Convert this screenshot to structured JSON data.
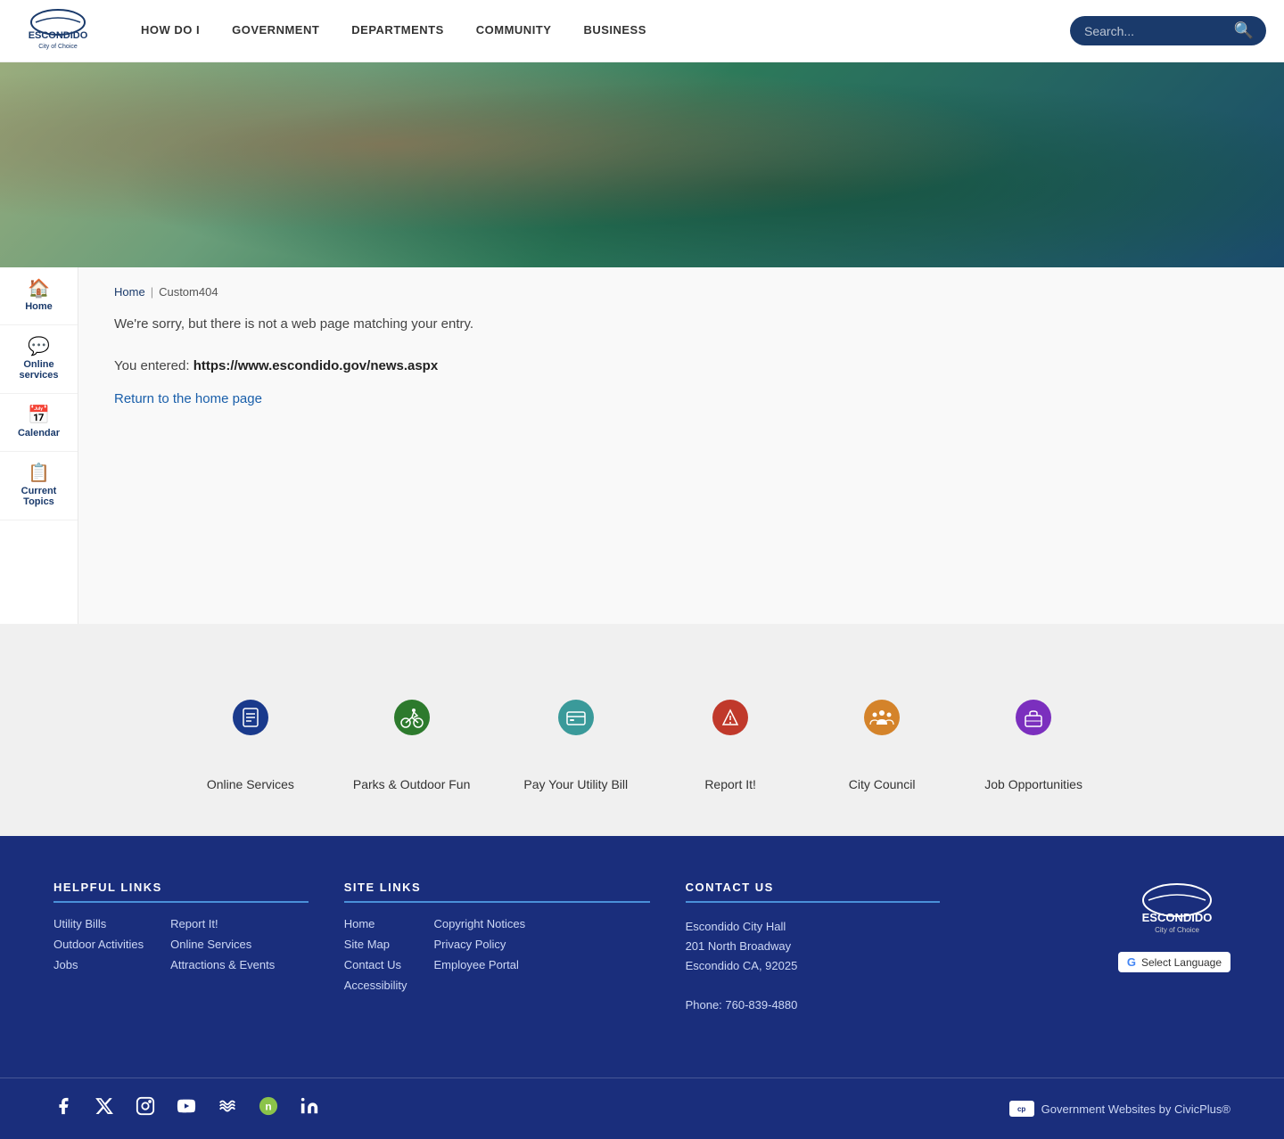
{
  "header": {
    "logo_alt": "Escondido City of Choice",
    "nav_items": [
      {
        "label": "HOW DO I",
        "id": "how-do-i"
      },
      {
        "label": "GOVERNMENT",
        "id": "government"
      },
      {
        "label": "DEPARTMENTS",
        "id": "departments"
      },
      {
        "label": "COMMUNITY",
        "id": "community"
      },
      {
        "label": "BUSINESS",
        "id": "business"
      }
    ],
    "search_placeholder": "Search..."
  },
  "sidebar": {
    "items": [
      {
        "label": "Home",
        "icon": "🏠",
        "id": "home"
      },
      {
        "label": "Online services",
        "icon": "💬",
        "id": "online-services"
      },
      {
        "label": "Calendar",
        "icon": "📅",
        "id": "calendar"
      },
      {
        "label": "Current Topics",
        "icon": "📋",
        "id": "current-topics"
      }
    ]
  },
  "breadcrumb": {
    "home_label": "Home",
    "separator": "|",
    "current": "Custom404"
  },
  "content": {
    "error_message": "We're sorry, but there is not a web page matching your entry.",
    "entered_label": "You entered:",
    "entered_url": "https://www.escondido.gov/news.aspx",
    "return_link_label": "Return to the home page"
  },
  "quick_links": [
    {
      "label": "Online Services",
      "icon": "📋",
      "color": "#1a3a8c",
      "border": "#1a3a8c"
    },
    {
      "label": "Parks & Outdoor Fun",
      "icon": "🚴",
      "color": "#2d7a2d",
      "border": "#2d7a2d"
    },
    {
      "label": "Pay Your Utility Bill",
      "icon": "💳",
      "color": "#3a9a9a",
      "border": "#3a9a9a"
    },
    {
      "label": "Report It!",
      "icon": "⚠️",
      "color": "#c0392b",
      "border": "#c0392b"
    },
    {
      "label": "City Council",
      "icon": "👥",
      "color": "#d4832a",
      "border": "#d4832a"
    },
    {
      "label": "Job Opportunities",
      "icon": "💼",
      "color": "#7b2fbe",
      "border": "#7b2fbe"
    }
  ],
  "footer": {
    "helpful_links": {
      "heading": "HELPFUL LINKS",
      "col1": [
        {
          "label": "Utility Bills"
        },
        {
          "label": "Outdoor Activities"
        },
        {
          "label": "Jobs"
        }
      ],
      "col2": [
        {
          "label": "Report It!"
        },
        {
          "label": "Online Services"
        },
        {
          "label": "Attractions & Events"
        }
      ]
    },
    "site_links": {
      "heading": "SITE LINKS",
      "col1": [
        {
          "label": "Home"
        },
        {
          "label": "Site Map"
        },
        {
          "label": "Contact Us"
        },
        {
          "label": "Accessibility"
        }
      ],
      "col2": [
        {
          "label": "Copyright Notices"
        },
        {
          "label": "Privacy Policy"
        },
        {
          "label": "Employee Portal"
        }
      ]
    },
    "contact_us": {
      "heading": "CONTACT US",
      "name": "Escondido City Hall",
      "address1": "201 North Broadway",
      "address2": "Escondido CA, 92025",
      "phone_label": "Phone:",
      "phone": "760-839-4880"
    },
    "translate_label": "Select Language",
    "civic_plus": "Government Websites by CivicPlus®"
  },
  "social": [
    {
      "name": "facebook",
      "icon": "f"
    },
    {
      "name": "twitter-x",
      "icon": "✕"
    },
    {
      "name": "instagram",
      "icon": "◻"
    },
    {
      "name": "youtube",
      "icon": "▶"
    },
    {
      "name": "nextdoor",
      "icon": "≋"
    },
    {
      "name": "nextdoor2",
      "icon": "n"
    },
    {
      "name": "linkedin",
      "icon": "in"
    }
  ]
}
